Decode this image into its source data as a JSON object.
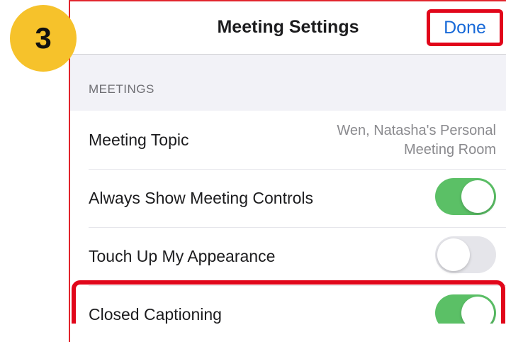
{
  "step_badge": {
    "number": "3",
    "color": "#f6c22b"
  },
  "nav": {
    "title": "Meeting Settings",
    "done_label": "Done"
  },
  "section": {
    "header": "MEETINGS"
  },
  "rows": [
    {
      "label": "Meeting Topic",
      "value_line1": "Wen, Natasha's Personal",
      "value_line2": "Meeting Room"
    },
    {
      "label": "Always Show Meeting Controls",
      "toggle": "on"
    },
    {
      "label": "Touch Up My Appearance",
      "toggle": "off"
    },
    {
      "label": "Closed Captioning",
      "toggle": "on"
    }
  ],
  "colors": {
    "accent": "#1769d8",
    "toggle_on": "#5bc066",
    "highlight": "#e1061a"
  }
}
